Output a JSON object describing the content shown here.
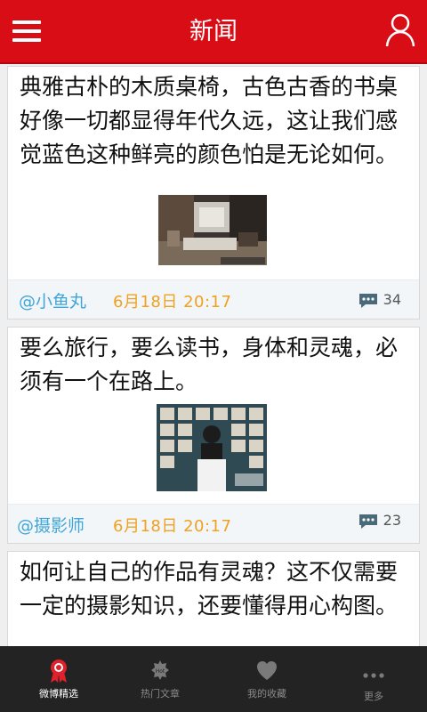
{
  "header": {
    "title": "新闻"
  },
  "posts": [
    {
      "text": "典雅古朴的木质桌椅，古色古香的书桌好像一切都显得年代久远，这让我们感觉蓝色这种鲜亮的颜色怕是无论如何。",
      "author": "@小鱼丸",
      "date": "6月18日  20:17",
      "comments": "34"
    },
    {
      "text": "要么旅行，要么读书，身体和灵魂，必须有一个在路上。",
      "author": "@摄影师",
      "date": "6月18日  20:17",
      "comments": "23"
    },
    {
      "text": "如何让自己的作品有灵魂？这不仅需要一定的摄影知识，还要懂得用心构图。"
    }
  ],
  "tabs": [
    {
      "label": "微博精选",
      "icon": "ribbon-icon",
      "active": true
    },
    {
      "label": "热门文章",
      "icon": "hot-icon",
      "active": false
    },
    {
      "label": "我的收藏",
      "icon": "heart-icon",
      "active": false
    },
    {
      "label": "更多",
      "icon": "more-icon",
      "active": false
    }
  ],
  "colors": {
    "header": "#d80d16",
    "author": "#3fa6d9",
    "date": "#f0a11f",
    "tabbar": "#232323"
  }
}
